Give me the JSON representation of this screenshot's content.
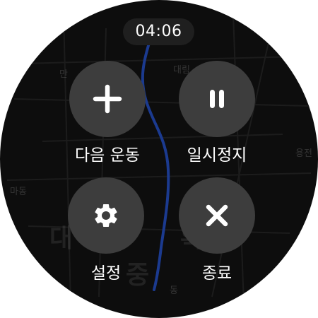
{
  "status": {
    "time": "04:06"
  },
  "actions": {
    "next_workout": {
      "label": "다음 운동",
      "icon": "plus-icon"
    },
    "pause": {
      "label": "일시정지",
      "icon": "pause-icon"
    },
    "settings": {
      "label": "설정",
      "icon": "gear-icon"
    },
    "end": {
      "label": "종료",
      "icon": "close-icon"
    }
  },
  "map": {
    "labels": [
      "만",
      "대림",
      "용전",
      "마동",
      "대",
      "확",
      "중",
      "동"
    ]
  },
  "colors": {
    "background": "#0d0d0d",
    "button": "#3d3d3d",
    "route": "#1b3a8f",
    "text": "#ffffff"
  }
}
